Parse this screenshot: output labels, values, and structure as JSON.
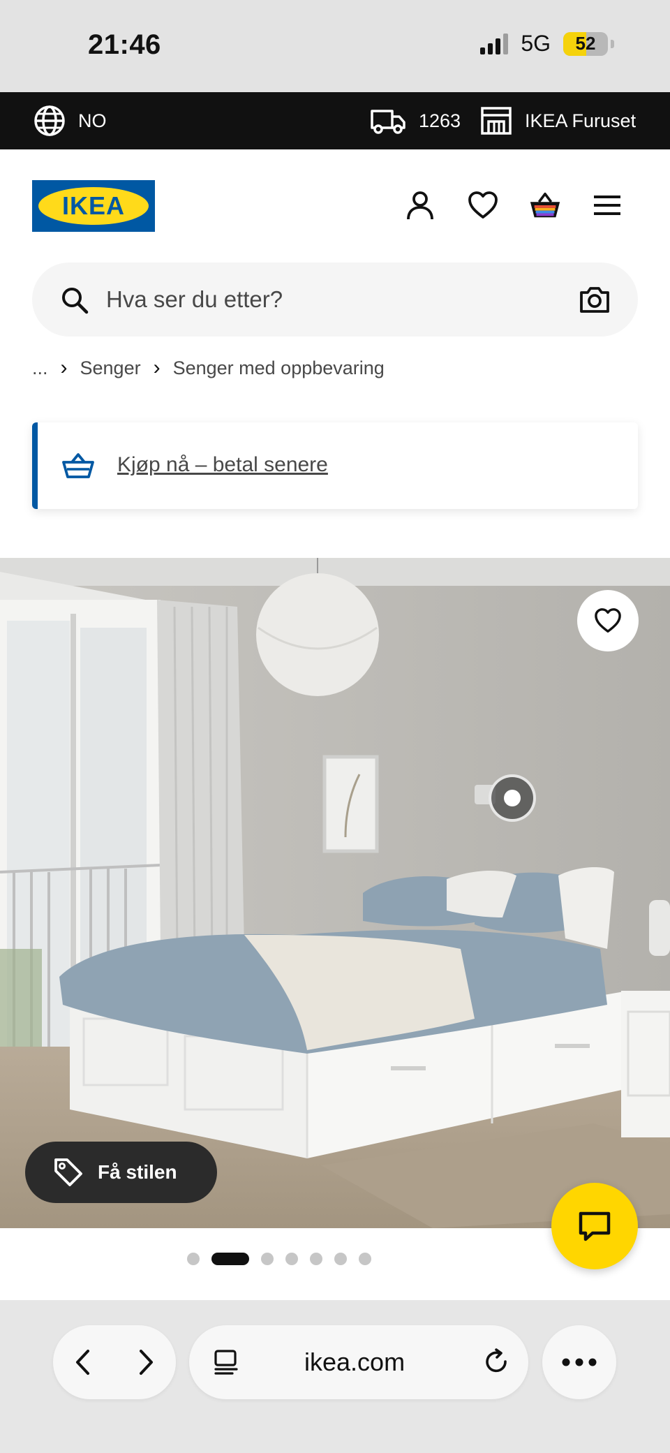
{
  "status_bar": {
    "time": "21:46",
    "network": "5G",
    "battery": "52",
    "battery_level": 0.52
  },
  "top_strip": {
    "language": "NO",
    "delivery_code": "1263",
    "store": "IKEA Furuset"
  },
  "header": {
    "logo_text": "IKEA",
    "icons": [
      "person-icon",
      "heart-icon",
      "basket-icon",
      "menu-icon"
    ]
  },
  "search": {
    "placeholder": "Hva ser du etter?"
  },
  "breadcrumb": {
    "ellipsis": "...",
    "items": [
      "Senger",
      "Senger med oppbevaring"
    ]
  },
  "promo": {
    "text": "Kjøp nå – betal senere"
  },
  "hero": {
    "style_button": "Få stilen",
    "pager_count": 7,
    "pager_active": 2
  },
  "browser": {
    "url": "ikea.com"
  },
  "colors": {
    "ikea_blue": "#0058a3",
    "ikea_yellow": "#ffda1a",
    "chat_yellow": "#ffd600"
  }
}
